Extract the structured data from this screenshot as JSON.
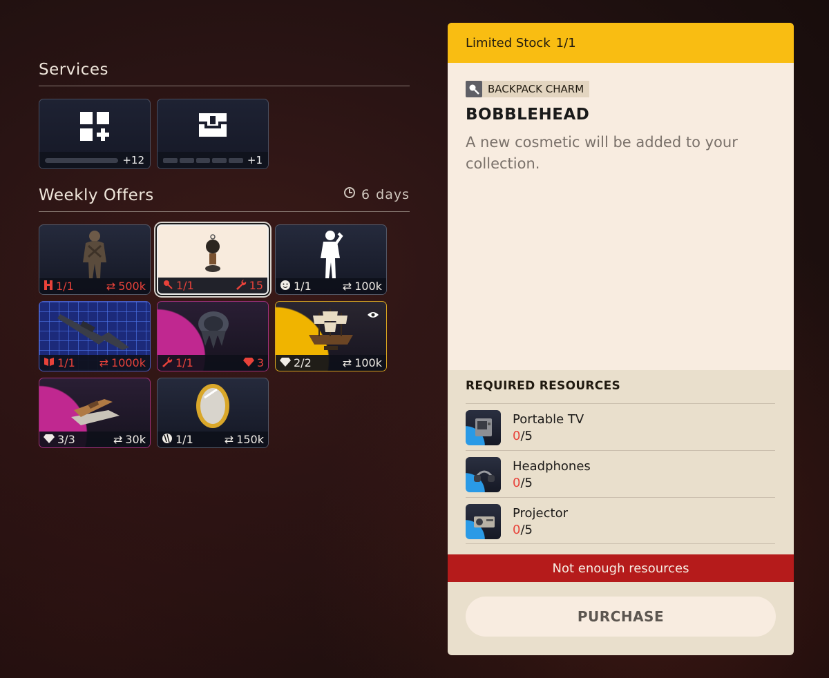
{
  "services": {
    "title": "Services",
    "items": [
      {
        "icon": "add-grid-icon",
        "count": "+12"
      },
      {
        "icon": "chest-icon",
        "count": "+1"
      }
    ]
  },
  "weekly": {
    "title": "Weekly Offers",
    "timer_value": "6",
    "timer_unit": "days",
    "offers": [
      {
        "name": "outfit",
        "left": "1/1",
        "right": "500k"
      },
      {
        "name": "bobblehead-charm",
        "left": "1/1",
        "right": "15"
      },
      {
        "name": "emote",
        "left": "1/1",
        "right": "100k"
      },
      {
        "name": "weapon-blueprint",
        "left": "1/1",
        "right": "1000k"
      },
      {
        "name": "gauntlet",
        "left": "1/1",
        "right": "3"
      },
      {
        "name": "ship-model",
        "left": "2/2",
        "right": "100k"
      },
      {
        "name": "boat-model",
        "left": "3/3",
        "right": "30k"
      },
      {
        "name": "mirror",
        "left": "1/1",
        "right": "150k"
      }
    ]
  },
  "panel": {
    "header_label": "Limited Stock",
    "header_stock": "1/1",
    "category": "BACKPACK CHARM",
    "item_name": "BOBBLEHEAD",
    "description": "A new cosmetic will be added to your collection.",
    "required_title": "REQUIRED RESOURCES",
    "resources": [
      {
        "name": "Portable TV",
        "have": "0",
        "need": "/5"
      },
      {
        "name": "Headphones",
        "have": "0",
        "need": "/5"
      },
      {
        "name": "Projector",
        "have": "0",
        "need": "/5"
      }
    ],
    "warning": "Not enough resources",
    "purchase_label": "PURCHASE"
  },
  "colors": {
    "accent_yellow": "#f9bd12",
    "warning_red": "#b51b1b",
    "price_red": "#e8423a",
    "panel_bg": "#e9dfcc"
  }
}
